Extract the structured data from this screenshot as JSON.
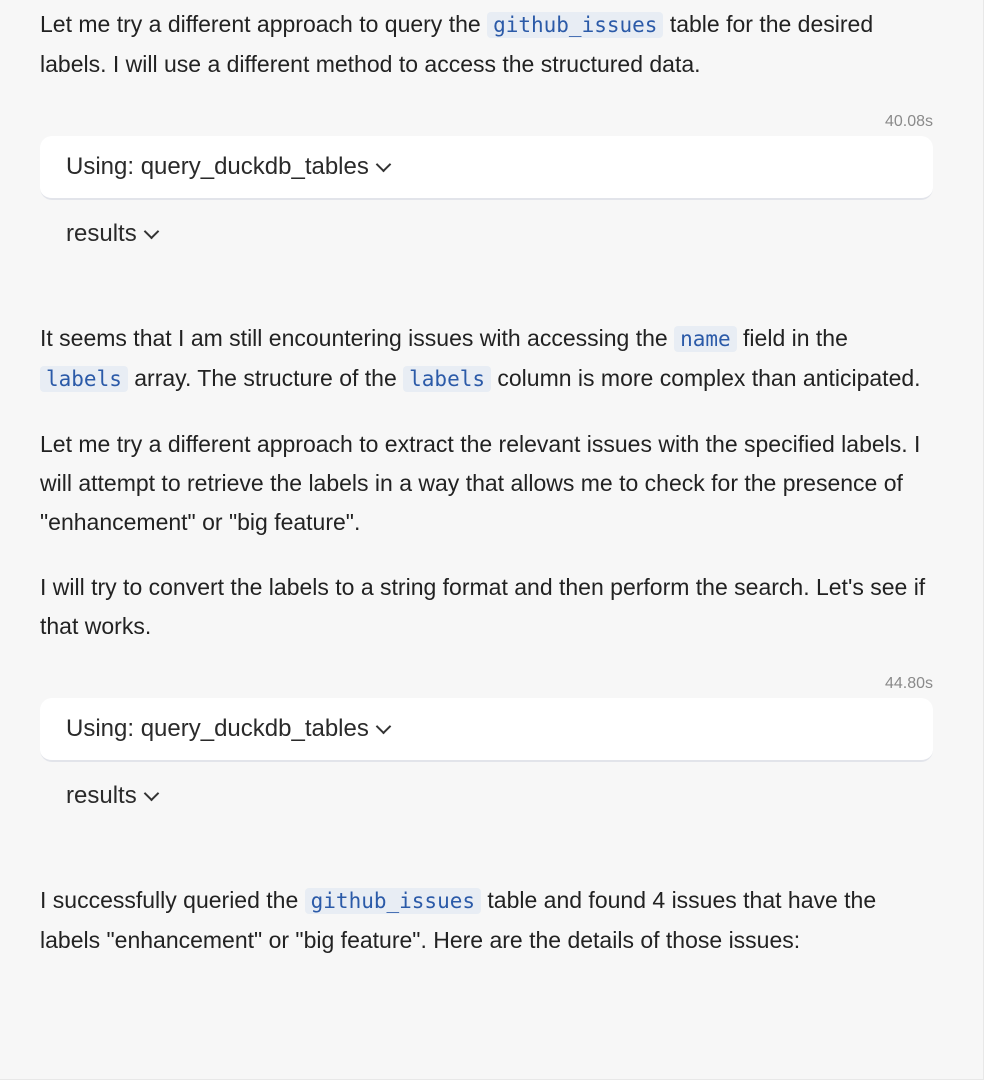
{
  "messages": {
    "m1": {
      "before": "Let me try a different approach to query the ",
      "code": "github_issues",
      "after": " table for the desired labels. I will use a different method to access the structured data."
    },
    "tool_calls": [
      {
        "timing": "40.08s",
        "label": "Using: query_duckdb_tables",
        "results_label": "results"
      },
      {
        "timing": "44.80s",
        "label": "Using: query_duckdb_tables",
        "results_label": "results"
      }
    ],
    "m2": {
      "t1": "It seems that I am still encountering issues with accessing the ",
      "c1": "name",
      "t2": " field in the ",
      "c2": "labels",
      "t3": " array. The structure of the ",
      "c3": "labels",
      "t4": " column is more complex than anticipated."
    },
    "m3": "Let me try a different approach to extract the relevant issues with the specified labels. I will attempt to retrieve the labels in a way that allows me to check for the presence of \"enhancement\" or \"big feature\".",
    "m4": "I will try to convert the labels to a string format and then perform the search. Let's see if that works.",
    "m5": {
      "before": "I successfully queried the ",
      "code": "github_issues",
      "after": " table and found 4 issues that have the labels \"enhancement\" or \"big feature\". Here are the details of those issues:"
    }
  }
}
